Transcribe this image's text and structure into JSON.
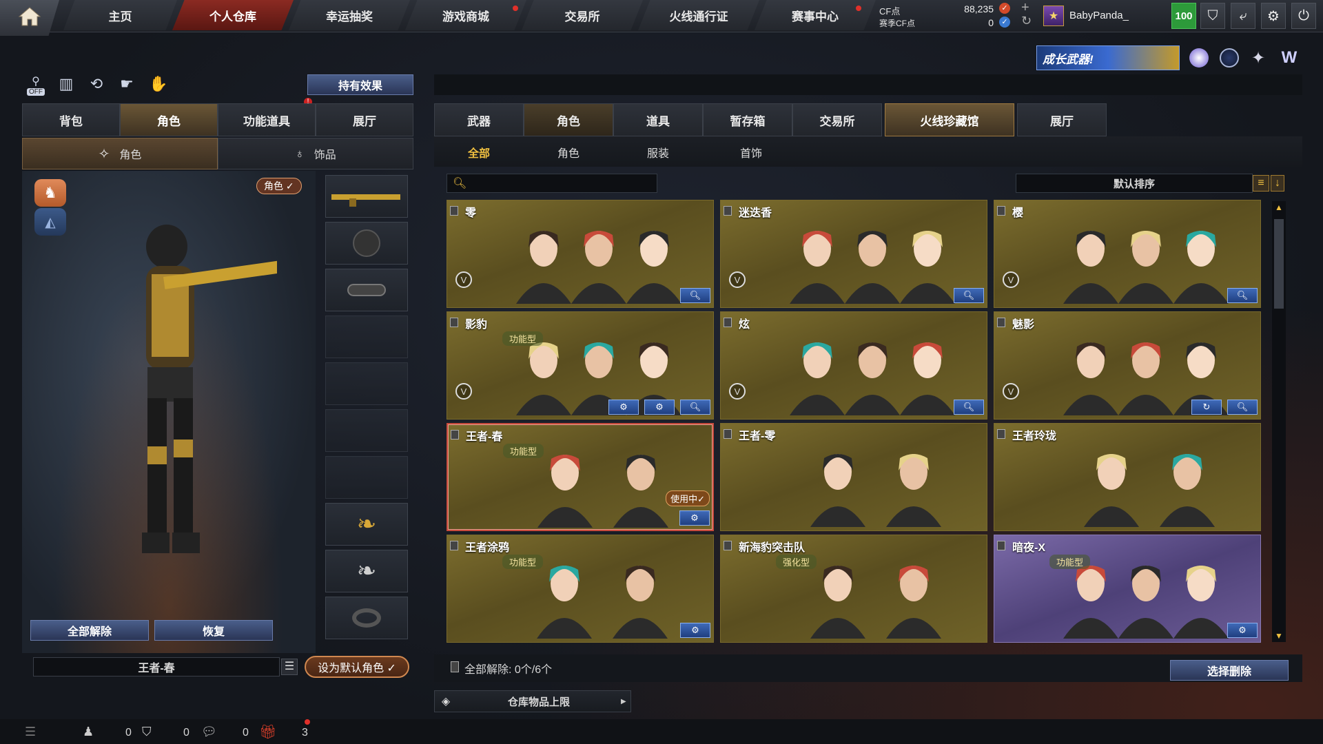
{
  "nav": {
    "tabs": [
      "主页",
      "个人仓库",
      "幸运抽奖",
      "游戏商城",
      "交易所",
      "火线通行证",
      "赛事中心"
    ],
    "active": "个人仓库"
  },
  "currency": {
    "cf_label": "CF点",
    "cf_value": "88,235",
    "season_label": "赛季CF点",
    "season_value": "0"
  },
  "user": {
    "name": "BabyPanda_",
    "level": "100"
  },
  "banner_text": "成长武器!",
  "left": {
    "effect_button": "持有效果",
    "tabs": [
      "背包",
      "角色",
      "功能道具",
      "展厅"
    ],
    "active_tab": "角色",
    "subtabs": [
      "角色",
      "饰品"
    ],
    "role_badge": "角色 ✓",
    "unequip_all": "全部解除",
    "restore": "恢复",
    "current_role": "王者-春",
    "set_default": "设为默认角色 ✓",
    "toggle_off": "OFF"
  },
  "right": {
    "tabs": [
      "武器",
      "角色",
      "道具",
      "暂存箱",
      "交易所",
      "火线珍藏馆",
      "展厅"
    ],
    "active_tab": "火线珍藏馆",
    "subtabs": [
      "全部",
      "角色",
      "服装",
      "首饰"
    ],
    "active_subtab": "全部",
    "sort_label": "默认排序",
    "search_placeholder": "",
    "cards": [
      {
        "name": "零",
        "type": "",
        "inuse": "",
        "buttons": [
          "search"
        ]
      },
      {
        "name": "迷迭香",
        "type": "",
        "inuse": "",
        "buttons": [
          "search"
        ]
      },
      {
        "name": "樱",
        "type": "",
        "inuse": "",
        "buttons": [
          "search"
        ]
      },
      {
        "name": "影豹",
        "type": "功能型",
        "inuse": "",
        "buttons": [
          "gear",
          "settings",
          "search"
        ]
      },
      {
        "name": "炫",
        "type": "",
        "inuse": "",
        "buttons": [
          "search"
        ]
      },
      {
        "name": "魅影",
        "type": "",
        "inuse": "",
        "buttons": [
          "refresh",
          "search"
        ]
      },
      {
        "name": "王者-春",
        "type": "功能型",
        "inuse": "使用中✓",
        "buttons": [
          "gear"
        ]
      },
      {
        "name": "王者-零",
        "type": "",
        "inuse": "",
        "buttons": []
      },
      {
        "name": "王者玲珑",
        "type": "",
        "inuse": "",
        "buttons": []
      },
      {
        "name": "王者涂鸦",
        "type": "功能型",
        "inuse": "",
        "buttons": [
          "gear"
        ]
      },
      {
        "name": "新海豹突击队",
        "type": "强化型",
        "inuse": "",
        "buttons": []
      },
      {
        "name": "暗夜-X",
        "type": "功能型",
        "inuse": "",
        "buttons": [
          "gear"
        ]
      }
    ],
    "unequip_status": "全部解除: 0个/6个",
    "select_delete": "选择删除",
    "storage_limit": "仓库物品上限"
  },
  "statusbar": {
    "count1": "0",
    "count2": "0",
    "count3": "0",
    "count4": "3"
  }
}
